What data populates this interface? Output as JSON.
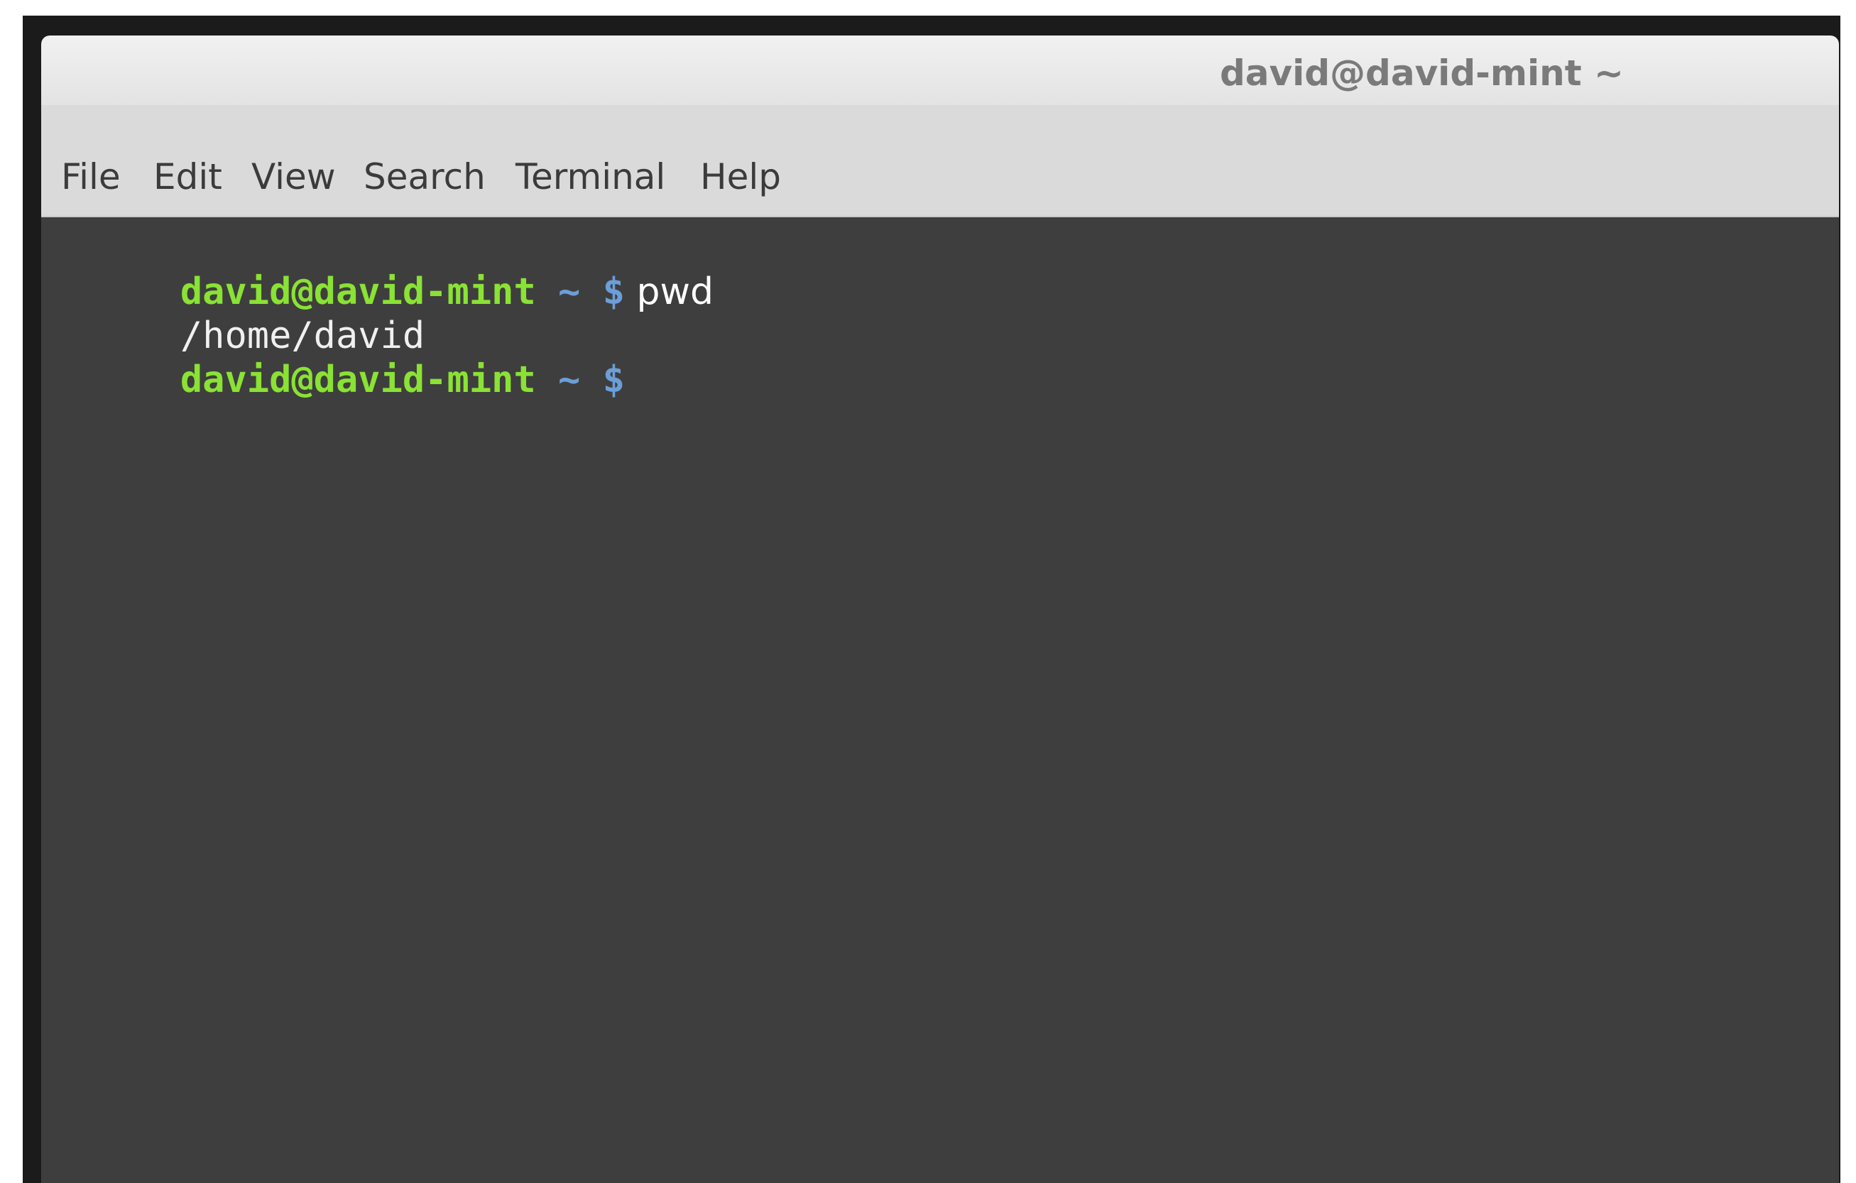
{
  "window": {
    "title": "david@david-mint ~"
  },
  "menu": {
    "items": [
      {
        "label": "File"
      },
      {
        "label": "Edit"
      },
      {
        "label": "View"
      },
      {
        "label": "Search"
      },
      {
        "label": "Terminal"
      },
      {
        "label": "Help"
      }
    ]
  },
  "terminal": {
    "lines": [
      {
        "prompt_user": "david@david-mint",
        "prompt_path": " ~ $",
        "command": " pwd"
      },
      {
        "output": "/home/david"
      },
      {
        "prompt_user": "david@david-mint",
        "prompt_path": " ~ $",
        "command": ""
      }
    ]
  },
  "colors": {
    "prompt_user": "#8ae234",
    "prompt_path": "#6c9ed7",
    "terminal_background": "#3e3e3e",
    "menubar_background": "#dadada"
  }
}
